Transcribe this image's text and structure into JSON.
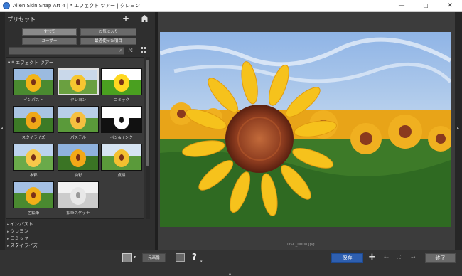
{
  "window": {
    "title": "Alien Skin Snap Art 4 | * エフェクト ツアー | クレヨン",
    "minimize": "—",
    "maximize": "☐",
    "close": "✕"
  },
  "presets": {
    "header": "プリセット",
    "add": "+",
    "filters": {
      "all": "すべて",
      "favorites": "お気に入り",
      "user": "ユーザー",
      "recent": "最近使った項目"
    },
    "search_placeholder": "",
    "group": "▾ * エフェクト ツアー",
    "items": [
      {
        "label": "インパスト"
      },
      {
        "label": "クレヨン"
      },
      {
        "label": "コミック"
      },
      {
        "label": "スタイライズ"
      },
      {
        "label": "パステル"
      },
      {
        "label": "ペン&インク"
      },
      {
        "label": "水彩"
      },
      {
        "label": "油彩"
      },
      {
        "label": "点描"
      },
      {
        "label": "色鉛筆"
      },
      {
        "label": "鉛筆スケッチ"
      }
    ],
    "tree": [
      "インパスト",
      "クレヨン",
      "コミック",
      "スタイライズ"
    ]
  },
  "canvas": {
    "filename": "DSC_0008.jpg"
  },
  "toolbar": {
    "original": "元画像",
    "save": "保存",
    "finish": "終了",
    "help": "?"
  },
  "colors": {
    "accent": "#2e5fb0",
    "sky": "#7fa6d8",
    "petal": "#f5b81a",
    "leaf": "#3d7a28"
  }
}
